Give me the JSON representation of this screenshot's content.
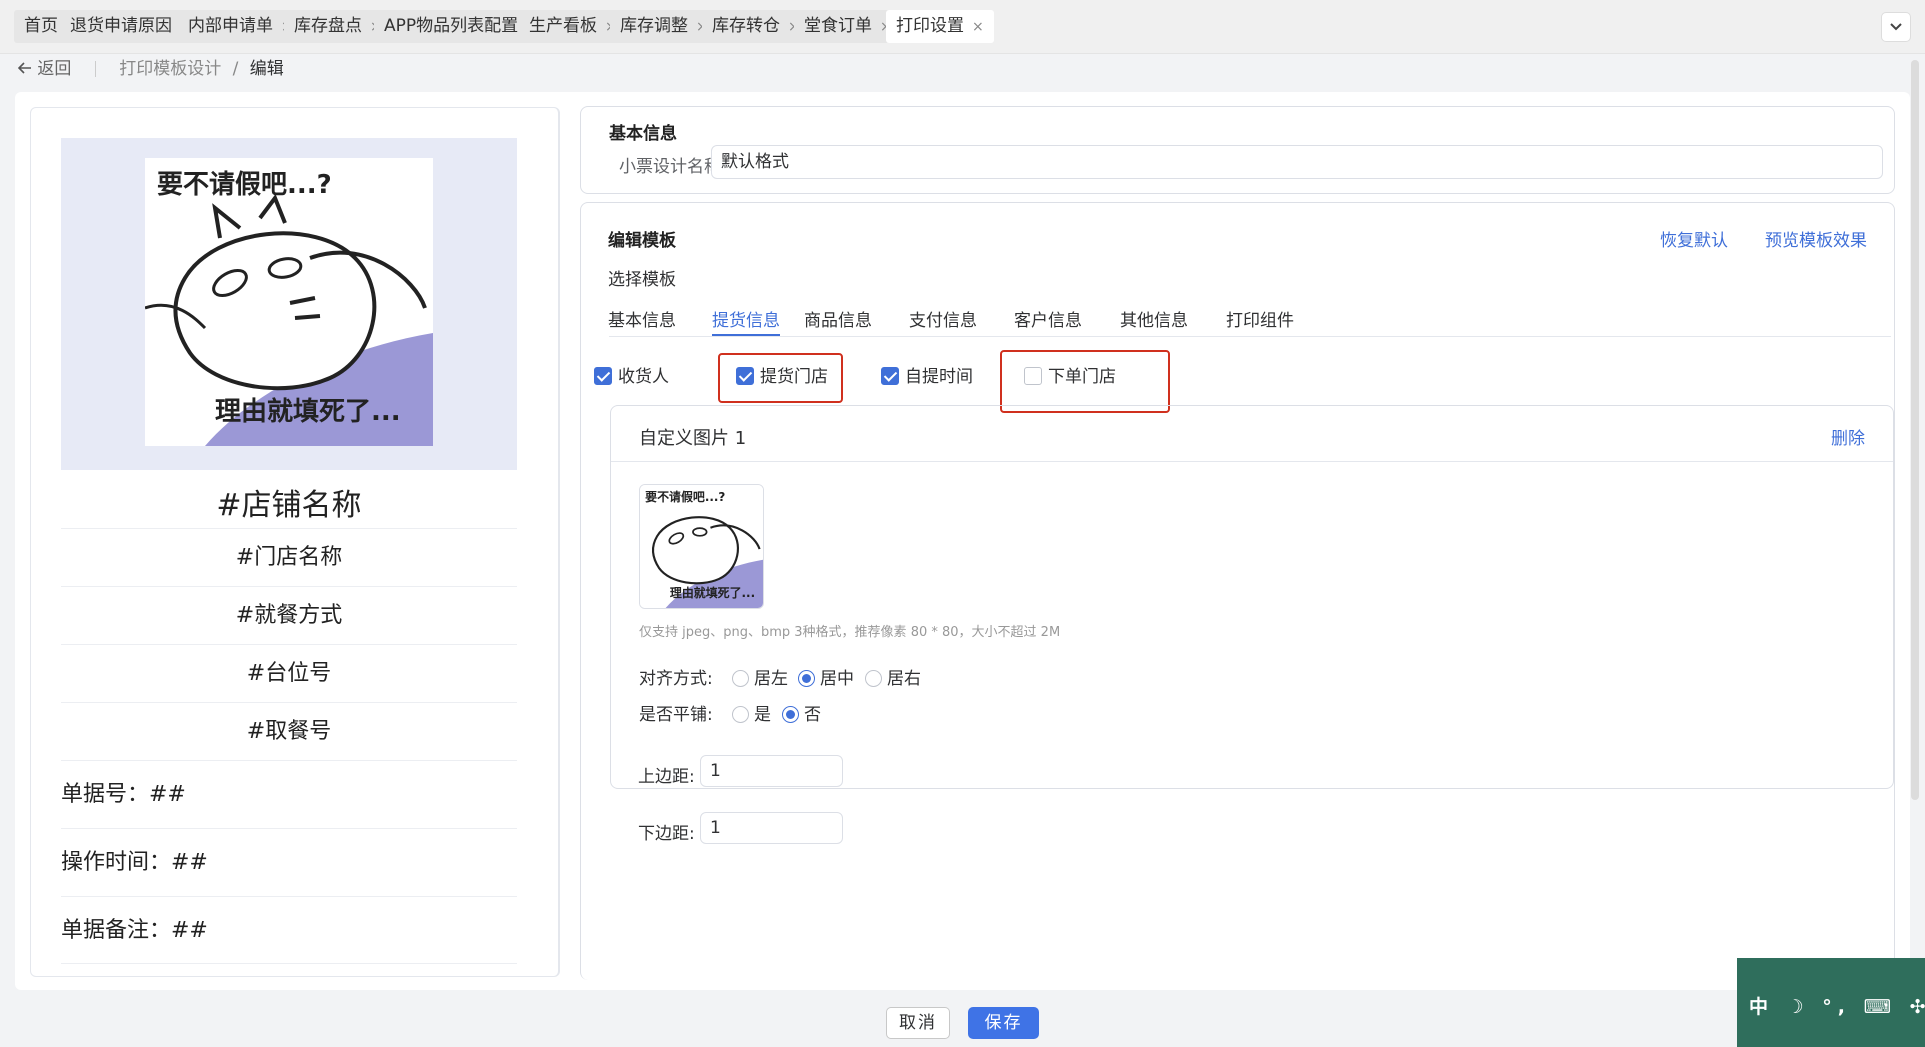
{
  "tabs": [
    {
      "label": "首页",
      "closable": false
    },
    {
      "label": "退货申请原因",
      "closable": true
    },
    {
      "label": "内部申请单",
      "closable": true
    },
    {
      "label": "库存盘点",
      "closable": true
    },
    {
      "label": "APP物品列表配置",
      "closable": true
    },
    {
      "label": "生产看板",
      "closable": true
    },
    {
      "label": "库存调整",
      "closable": true
    },
    {
      "label": "库存转仓",
      "closable": true
    },
    {
      "label": "堂食订单",
      "closable": true
    },
    {
      "label": "打印设置",
      "closable": true,
      "active": true
    }
  ],
  "close_glyph": "×",
  "breadcrumb": {
    "back_label": "返回",
    "items": [
      "打印模板设计",
      "编辑"
    ],
    "separator": "/"
  },
  "preview": {
    "meme_top_text": "要不请假吧...?",
    "meme_bottom_text": "理由就填死了...",
    "shop_name": "#店铺名称",
    "center_rows": [
      "#门店名称",
      "#就餐方式",
      "#台位号",
      "#取餐号"
    ],
    "left_rows": [
      "单据号：##",
      "操作时间：##",
      "单据备注：##"
    ]
  },
  "basic_info": {
    "title": "基本信息",
    "name_label": "小票设计名称",
    "name_value": "默认格式"
  },
  "edit_template": {
    "title": "编辑模板",
    "restore_label": "恢复默认",
    "preview_label": "预览模板效果",
    "select_label": "选择模板",
    "subtabs": [
      "基本信息",
      "提货信息",
      "商品信息",
      "支付信息",
      "客户信息",
      "其他信息",
      "打印组件"
    ],
    "active_subtab": "提货信息",
    "checkboxes": [
      {
        "label": "收货人",
        "checked": true
      },
      {
        "label": "提货门店",
        "checked": true
      },
      {
        "label": "自提时间",
        "checked": true
      },
      {
        "label": "下单门店",
        "checked": false
      }
    ],
    "custom_image": {
      "title": "自定义图片 1",
      "delete_label": "删除",
      "hint": "仅支持 jpeg、png、bmp 3种格式，推荐像素 80 * 80，大小不超过 2M",
      "align_label": "对齐方式:",
      "align_options": [
        "居左",
        "居中",
        "居右"
      ],
      "align_selected": "居中",
      "tile_label": "是否平铺:",
      "tile_options": [
        "是",
        "否"
      ],
      "tile_selected": "否",
      "top_margin_label": "上边距:",
      "top_margin_value": "1",
      "bottom_margin_label": "下边距:",
      "bottom_margin_value": "1"
    }
  },
  "buttons": {
    "cancel": "取消",
    "save": "保存"
  },
  "ime": {
    "text": "中 ☽ °, ⌨ ✣ ✎"
  },
  "colors": {
    "accent": "#3f6fd8",
    "highlight_box": "#d0301e",
    "ime_bg": "#2f6e5c"
  }
}
